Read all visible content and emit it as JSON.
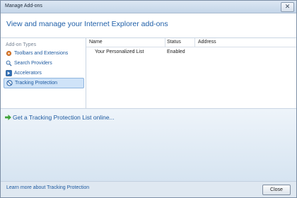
{
  "window": {
    "title": "Manage Add-ons"
  },
  "header": {
    "title": "View and manage your Internet Explorer add-ons"
  },
  "sidebar": {
    "section_label": "Add-on Types",
    "items": [
      {
        "label": "Toolbars and Extensions",
        "icon": "gear-icon",
        "selected": false
      },
      {
        "label": "Search Providers",
        "icon": "search-icon",
        "selected": false
      },
      {
        "label": "Accelerators",
        "icon": "accelerator-icon",
        "selected": false
      },
      {
        "label": "Tracking Protection",
        "icon": "no-entry-icon",
        "selected": true
      }
    ]
  },
  "list": {
    "columns": [
      "Name",
      "Status",
      "Address"
    ],
    "rows": [
      {
        "name": "Your Personalized List",
        "status": "Enabled",
        "address": ""
      }
    ]
  },
  "bottom": {
    "get_list_link": "Get a Tracking Protection List online..."
  },
  "footer": {
    "learn_more_link": "Learn more about Tracking Protection",
    "close_label": "Close"
  },
  "colors": {
    "link": "#1e5aa0",
    "header_title": "#1f5fa8",
    "selection": "#cfe3f8"
  }
}
